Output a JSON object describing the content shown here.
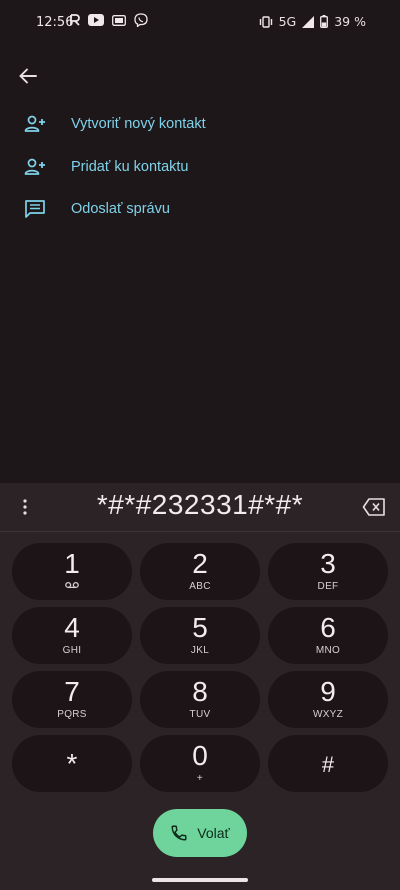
{
  "status_bar": {
    "time": "12:56",
    "network": "5G",
    "battery": "39 %",
    "icons": [
      "r-icon",
      "youtube-icon",
      "cast-icon",
      "viber-icon",
      "vibrate-icon",
      "signal-icon",
      "battery-icon"
    ]
  },
  "contact_actions": [
    {
      "label": "Vytvoriť nový kontakt",
      "icon": "add-person-icon"
    },
    {
      "label": "Pridať ku kontaktu",
      "icon": "add-person-icon"
    },
    {
      "label": "Odoslať správu",
      "icon": "message-icon"
    }
  ],
  "dialer": {
    "number": "*#*#232331#*#*",
    "keys": [
      {
        "digit": "1",
        "letters": ""
      },
      {
        "digit": "2",
        "letters": "ABC"
      },
      {
        "digit": "3",
        "letters": "DEF"
      },
      {
        "digit": "4",
        "letters": "GHI"
      },
      {
        "digit": "5",
        "letters": "JKL"
      },
      {
        "digit": "6",
        "letters": "MNO"
      },
      {
        "digit": "7",
        "letters": "PQRS"
      },
      {
        "digit": "8",
        "letters": "TUV"
      },
      {
        "digit": "9",
        "letters": "WXYZ"
      },
      {
        "digit": "*",
        "letters": ""
      },
      {
        "digit": "0",
        "letters": "+"
      },
      {
        "digit": "#",
        "letters": ""
      }
    ],
    "call_label": "Volať"
  },
  "colors": {
    "background": "#1e1719",
    "accent_text": "#7fd2e9",
    "call_button": "#6ed49b",
    "keypad_panel": "#2b2325",
    "key_bg": "#1c1416"
  }
}
